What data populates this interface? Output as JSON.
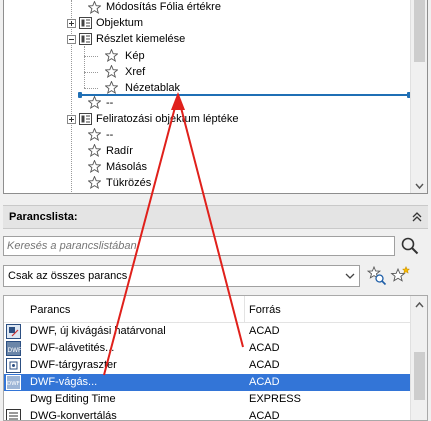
{
  "tree": {
    "items": [
      {
        "label": "Módosítás Fólia értékre"
      },
      {
        "label": "Objektum"
      },
      {
        "label": "Részlet kiemelése"
      },
      {
        "label": "Kép"
      },
      {
        "label": "Xref"
      },
      {
        "label": "Nézetablak"
      },
      {
        "label": "--"
      },
      {
        "label": "Feliratozási objektum léptéke"
      },
      {
        "label": "--"
      },
      {
        "label": "Radír"
      },
      {
        "label": "Másolás"
      },
      {
        "label": "Tükrözés"
      }
    ]
  },
  "command_list": {
    "title": "Parancslista:",
    "search_placeholder": "Keresés a parancslistában",
    "filter_value": "Csak az összes parancs",
    "columns": {
      "command": "Parancs",
      "source": "Forrás"
    },
    "rows": [
      {
        "name": "DWF, új kivágási határvonal",
        "source": "ACAD",
        "selected": false
      },
      {
        "name": "DWF-aláve­tités...",
        "source": "ACAD",
        "selected": false
      },
      {
        "name": "DWF-tárgyraszter",
        "source": "ACAD",
        "selected": false
      },
      {
        "name": "DWF-vágás...",
        "source": "ACAD",
        "selected": true
      },
      {
        "name": "Dwg Editing Time",
        "source": "EXPRESS",
        "selected": false
      },
      {
        "name": "DWG-konvertálás",
        "source": "ACAD",
        "selected": false
      }
    ]
  },
  "colors": {
    "selection": "#3375d7",
    "drop_line": "#1f6fb5",
    "drag_arrow": "#e0201b"
  }
}
